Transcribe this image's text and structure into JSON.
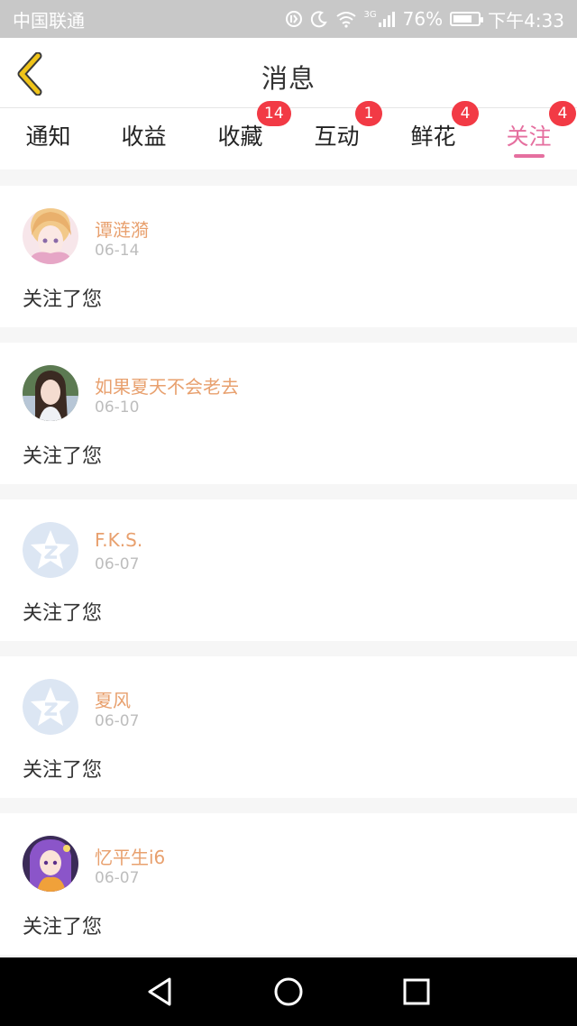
{
  "status_bar": {
    "carrier": "中国联通",
    "network": "3G",
    "battery": "76%",
    "battery_level": 0.76,
    "time": "下午4:33"
  },
  "header": {
    "title": "消息",
    "back_icon": "chevron-left-icon"
  },
  "tabs": [
    {
      "label": "通知",
      "badge": ""
    },
    {
      "label": "收益",
      "badge": ""
    },
    {
      "label": "收藏",
      "badge": "14"
    },
    {
      "label": "互动",
      "badge": "1"
    },
    {
      "label": "鲜花",
      "badge": "4"
    },
    {
      "label": "关注",
      "badge": "4",
      "active": true
    }
  ],
  "messages": [
    {
      "name": "谭涟漪",
      "date": "06-14",
      "text": "关注了您"
    },
    {
      "name": "如果夏天不会老去",
      "date": "06-10",
      "text": "关注了您"
    },
    {
      "name": "F.K.S.",
      "date": "06-07",
      "text": "关注了您"
    },
    {
      "name": "夏风",
      "date": "06-07",
      "text": "关注了您"
    },
    {
      "name": "忆平生i6",
      "date": "06-07",
      "text": "关注了您"
    }
  ],
  "colors": {
    "accent": "#e56f9f",
    "badge": "#f23a45",
    "username": "#e8a06e",
    "back_arrow": "#f0c419"
  }
}
